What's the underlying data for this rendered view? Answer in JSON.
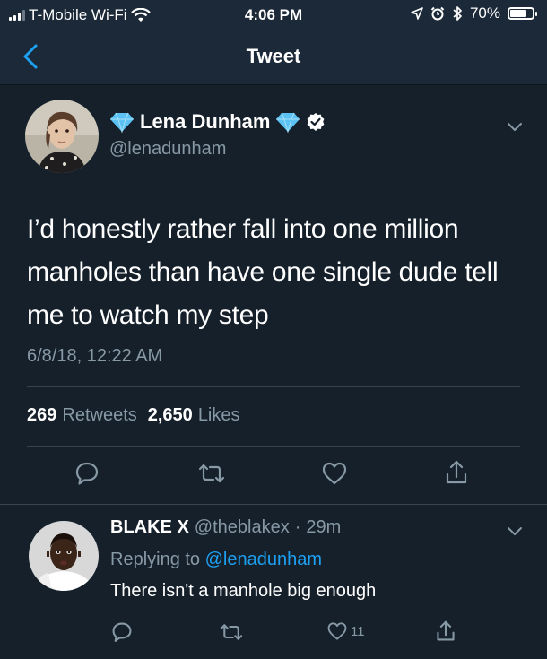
{
  "status_bar": {
    "carrier": "T-Mobile Wi-Fi",
    "time": "4:06 PM",
    "battery": "70%",
    "battery_level": 0.7
  },
  "nav": {
    "title": "Tweet",
    "back_icon": "chevron-left-icon"
  },
  "tweet": {
    "display_name": "Lena Dunham",
    "handle": "@lenadunham",
    "text": "I’d honestly rather fall into one million manholes than have one single dude tell me to watch my step",
    "timestamp": "6/8/18, 12:22 AM",
    "retweets_count": "269",
    "retweets_label": "Retweets",
    "likes_count": "2,650",
    "likes_label": "Likes"
  },
  "reply": {
    "display_name": "BLAKE X",
    "handle": "@theblakex",
    "separator": "·",
    "time_ago": "29m",
    "replying_to_label": "Replying to",
    "replying_to_handle": "@lenadunham",
    "text": "There isn't a manhole big enough",
    "like_count": "11"
  },
  "colors": {
    "background": "#15202b",
    "bar": "#1c2938",
    "accent": "#1da1f2",
    "muted": "#8899a6"
  }
}
